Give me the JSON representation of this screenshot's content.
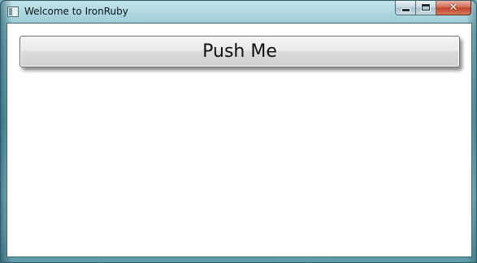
{
  "window": {
    "title": "Welcome to IronRuby",
    "icon": "app-window-icon",
    "caption_buttons": [
      {
        "name": "minimize",
        "icon": "minimize-icon"
      },
      {
        "name": "maximize",
        "icon": "maximize-icon"
      },
      {
        "name": "close",
        "icon": "close-icon",
        "glyph": "✕"
      }
    ]
  },
  "main": {
    "button_label": "Push Me"
  },
  "colors": {
    "frame": "#6fa7b4",
    "close_button": "#c0442b",
    "client_background": "#ffffff"
  }
}
